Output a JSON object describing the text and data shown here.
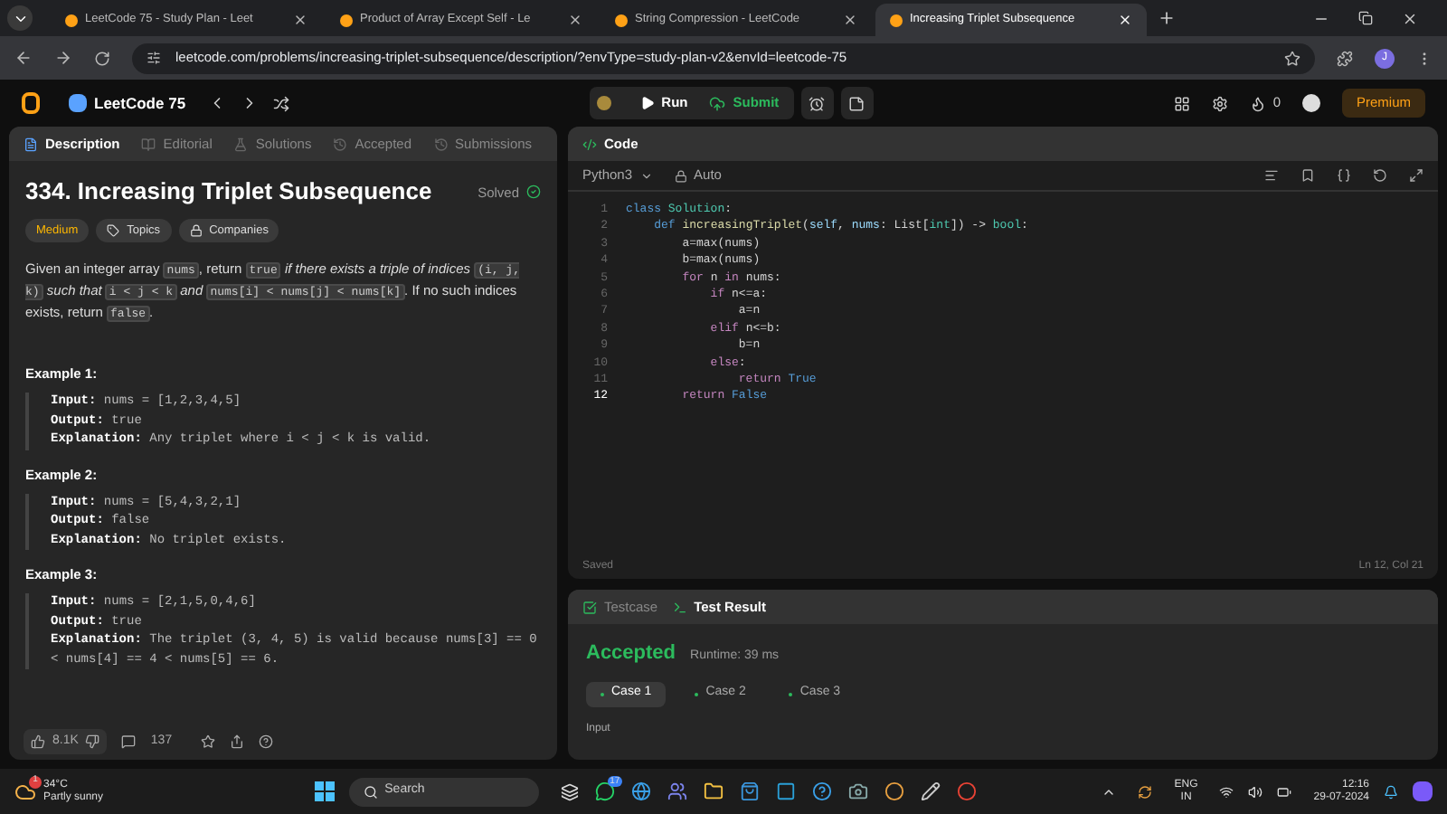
{
  "browser": {
    "tabs": [
      {
        "title": "LeetCode 75 - Study Plan - Leet",
        "selected": false
      },
      {
        "title": "Product of Array Except Self - Le",
        "selected": false
      },
      {
        "title": "String Compression - LeetCode",
        "selected": false
      },
      {
        "title": "Increasing Triplet Subsequence",
        "selected": true
      }
    ],
    "url": "leetcode.com/problems/increasing-triplet-subsequence/description/?envType=study-plan-v2&envId=leetcode-75",
    "profile": "J"
  },
  "header": {
    "title": "LeetCode 75",
    "run": "Run",
    "submit": "Submit",
    "streak": "0",
    "premium": "Premium"
  },
  "problem": {
    "tabs": [
      {
        "label": "Description",
        "selected": true
      },
      {
        "label": "Editorial",
        "selected": false
      },
      {
        "label": "Solutions",
        "selected": false
      },
      {
        "label": "Accepted",
        "selected": false
      },
      {
        "label": "Submissions",
        "selected": false
      }
    ],
    "title": "334. Increasing Triplet Subsequence",
    "status": "Solved",
    "tags": [
      {
        "label": "Medium",
        "kind": "difficulty"
      },
      {
        "label": "Topics",
        "kind": "topics"
      },
      {
        "label": "Companies",
        "kind": "companies"
      }
    ],
    "description": [
      {
        "text": "Given an integer array ",
        "kind": "text"
      },
      {
        "text": "nums",
        "kind": "code"
      },
      {
        "text": ", return ",
        "kind": "text"
      },
      {
        "text": "true",
        "kind": "code"
      },
      {
        "text": " if there exists a triple of indices ",
        "kind": "italic"
      },
      {
        "text": "(i, j, k)",
        "kind": "code"
      },
      {
        "text": " such that ",
        "kind": "italic"
      },
      {
        "text": "i < j < k",
        "kind": "code"
      },
      {
        "text": " and ",
        "kind": "italic"
      },
      {
        "text": "nums[i] < nums[j] < nums[k]",
        "kind": "code"
      },
      {
        "text": ". If no such indices exists, return ",
        "kind": "text"
      },
      {
        "text": "false",
        "kind": "code"
      },
      {
        "text": ".",
        "kind": "text"
      }
    ],
    "examples": [
      {
        "heading": "Example 1:",
        "input_label": "Input:",
        "input": "nums = [1,2,3,4,5]",
        "output_label": "Output:",
        "output": "true",
        "explanation_label": "Explanation:",
        "explanation": "Any triplet where i < j < k is valid."
      },
      {
        "heading": "Example 2:",
        "input_label": "Input:",
        "input": "nums = [5,4,3,2,1]",
        "output_label": "Output:",
        "output": "false",
        "explanation_label": "Explanation:",
        "explanation": "No triplet exists."
      },
      {
        "heading": "Example 3:",
        "input_label": "Input:",
        "input": "nums = [2,1,5,0,4,6]",
        "output_label": "Output:",
        "output": "true",
        "explanation_label": "Explanation:",
        "explanation": "The triplet (3, 4, 5) is valid because nums[3] == 0 < nums[4] == 4 < nums[5] == 6."
      }
    ],
    "likes": "8.1K",
    "comments": "137"
  },
  "editor": {
    "title": "Code",
    "language": "Python3",
    "mode": "Auto",
    "lines": [
      {
        "number": "1",
        "current": false,
        "tokens": [
          {
            "text": "class ",
            "kind": "kw"
          },
          {
            "text": "Solution",
            "kind": "type"
          },
          {
            "text": ":",
            "kind": "plain"
          }
        ]
      },
      {
        "number": "2",
        "current": false,
        "tokens": [
          {
            "text": "    def ",
            "kind": "kw"
          },
          {
            "text": "increasingTriplet",
            "kind": "fn"
          },
          {
            "text": "(",
            "kind": "plain"
          },
          {
            "text": "self",
            "kind": "var"
          },
          {
            "text": ", ",
            "kind": "plain"
          },
          {
            "text": "nums",
            "kind": "var"
          },
          {
            "text": ": List[",
            "kind": "plain"
          },
          {
            "text": "int",
            "kind": "type"
          },
          {
            "text": "]) -> ",
            "kind": "plain"
          },
          {
            "text": "bool",
            "kind": "type"
          },
          {
            "text": ":",
            "kind": "plain"
          }
        ]
      },
      {
        "number": "3",
        "current": false,
        "tokens": [
          {
            "text": "        a=max(nums)",
            "kind": "plain"
          }
        ]
      },
      {
        "number": "4",
        "current": false,
        "tokens": [
          {
            "text": "        b=max(nums)",
            "kind": "plain"
          }
        ]
      },
      {
        "number": "5",
        "current": false,
        "tokens": [
          {
            "text": "        for ",
            "kind": "ctl"
          },
          {
            "text": "n ",
            "kind": "plain"
          },
          {
            "text": "in ",
            "kind": "ctl"
          },
          {
            "text": "nums:",
            "kind": "plain"
          }
        ]
      },
      {
        "number": "6",
        "current": false,
        "tokens": [
          {
            "text": "            if ",
            "kind": "ctl"
          },
          {
            "text": "n<=a:",
            "kind": "plain"
          }
        ]
      },
      {
        "number": "7",
        "current": false,
        "tokens": [
          {
            "text": "                a=n",
            "kind": "plain"
          }
        ]
      },
      {
        "number": "8",
        "current": false,
        "tokens": [
          {
            "text": "            elif ",
            "kind": "ctl"
          },
          {
            "text": "n<=b:",
            "kind": "plain"
          }
        ]
      },
      {
        "number": "9",
        "current": false,
        "tokens": [
          {
            "text": "                b=n",
            "kind": "plain"
          }
        ]
      },
      {
        "number": "10",
        "current": false,
        "tokens": [
          {
            "text": "            else",
            "kind": "ctl"
          },
          {
            "text": ":",
            "kind": "plain"
          }
        ]
      },
      {
        "number": "11",
        "current": false,
        "tokens": [
          {
            "text": "                return ",
            "kind": "ctl"
          },
          {
            "text": "True",
            "kind": "kw"
          }
        ]
      },
      {
        "number": "12",
        "current": true,
        "tokens": [
          {
            "text": "        return ",
            "kind": "ctl"
          },
          {
            "text": "False",
            "kind": "kw"
          }
        ]
      }
    ],
    "status": "Saved",
    "cursor": "Ln 12, Col 21"
  },
  "test": {
    "tabs": [
      {
        "label": "Testcase",
        "selected": false
      },
      {
        "label": "Test Result",
        "selected": true
      }
    ],
    "verdict": "Accepted",
    "runtime": "Runtime: 39 ms",
    "cases": [
      {
        "label": "Case 1",
        "selected": true
      },
      {
        "label": "Case 2",
        "selected": false
      },
      {
        "label": "Case 3",
        "selected": false
      }
    ],
    "input_label": "Input"
  },
  "taskbar": {
    "temperature": "34°C",
    "weather": "Partly sunny",
    "weather_badge": "1",
    "search": "Search",
    "chat_badge": "17",
    "language": "ENG",
    "region": "IN",
    "time": "12:16",
    "date": "29-07-2024"
  }
}
